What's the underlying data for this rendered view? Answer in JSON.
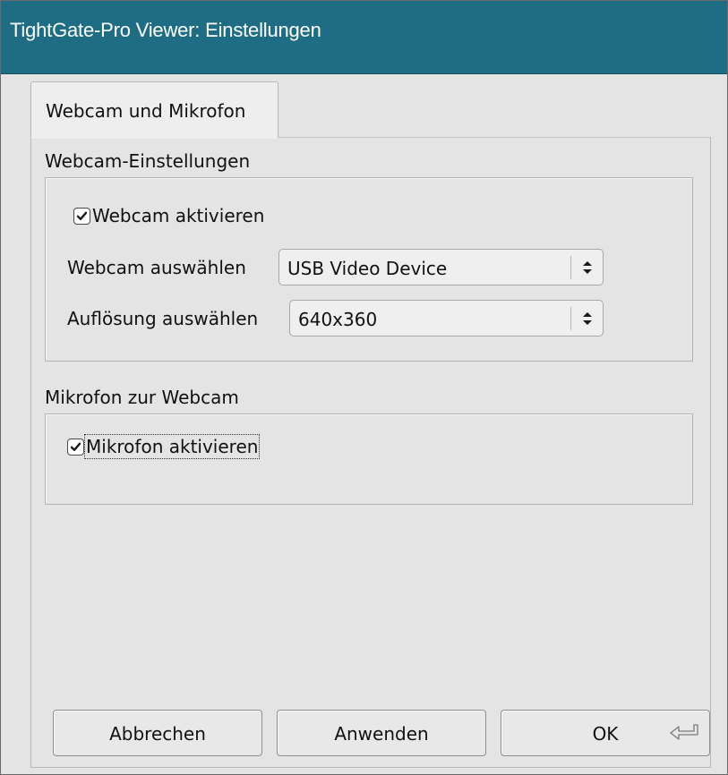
{
  "window": {
    "title": "TightGate-Pro Viewer: Einstellungen"
  },
  "tabs": [
    {
      "label": "Webcam und Mikrofon",
      "selected": true
    }
  ],
  "webcam_group": {
    "title": "Webcam-Einstellungen",
    "enable_checkbox": {
      "label": "Webcam aktivieren",
      "checked": true
    },
    "device": {
      "label": "Webcam auswählen",
      "value": "USB Video Device"
    },
    "resolution": {
      "label": "Auflösung auswählen",
      "value": "640x360"
    }
  },
  "mic_group": {
    "title": "Mikrofon zur Webcam",
    "enable_checkbox": {
      "label": "Mikrofon aktivieren",
      "checked": true
    }
  },
  "buttons": {
    "cancel": "Abbrechen",
    "apply": "Anwenden",
    "ok": "OK"
  },
  "colors": {
    "titlebar": "#1e6d85",
    "dialog_bg": "#e4e4e4"
  }
}
